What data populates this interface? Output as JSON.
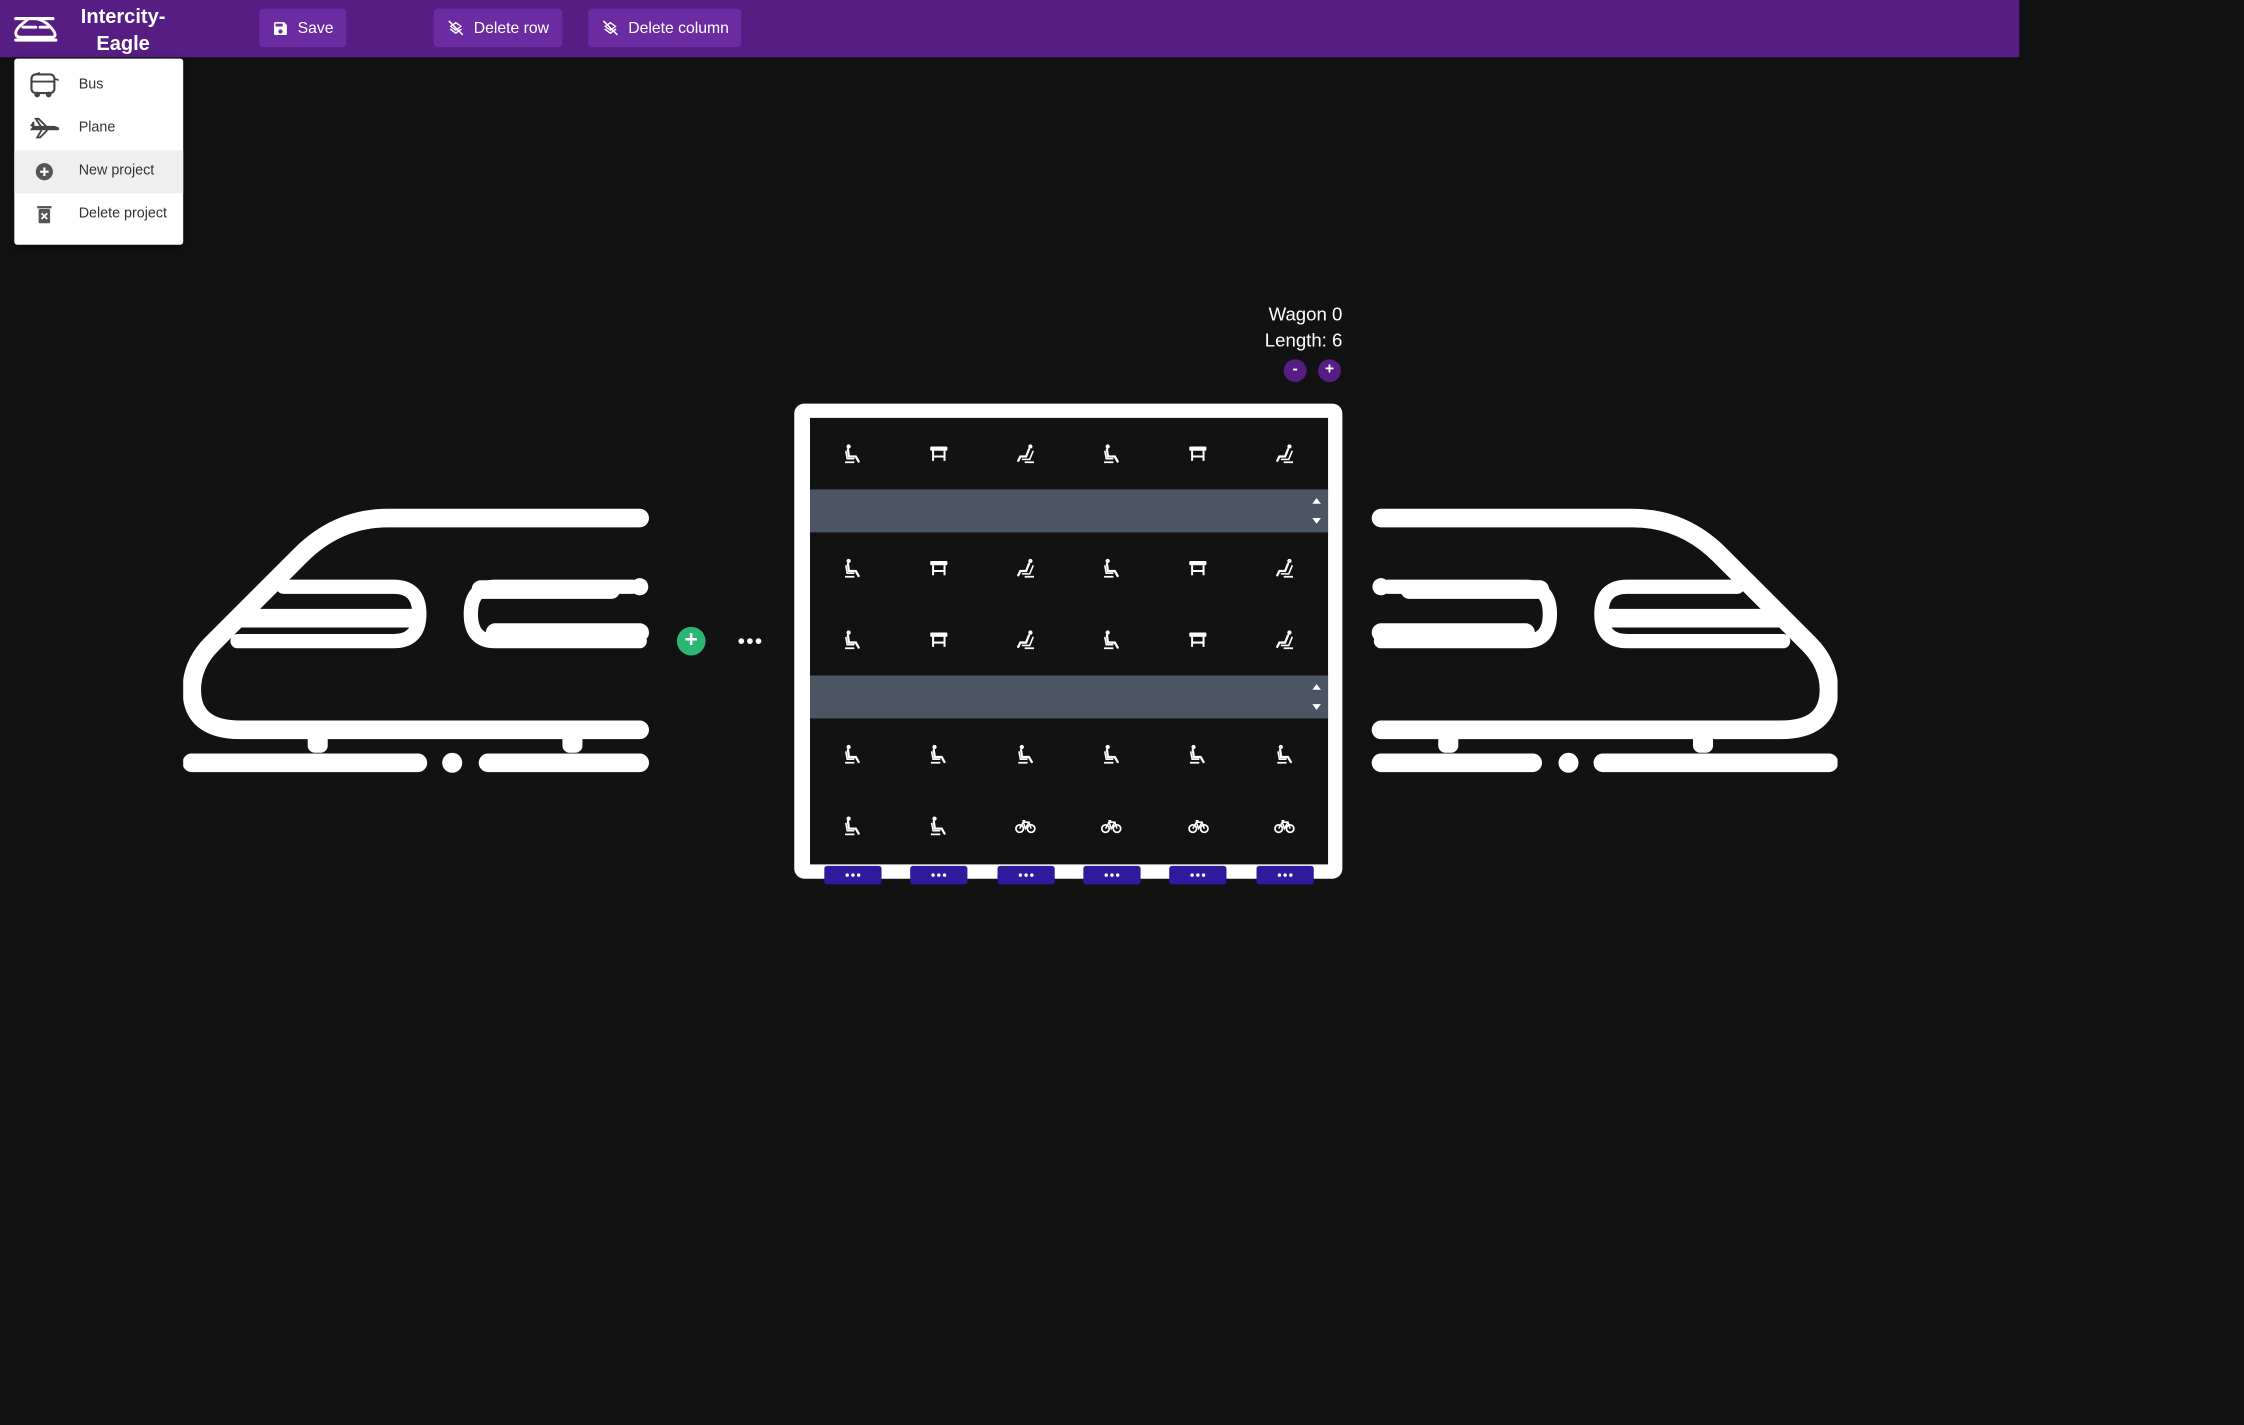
{
  "app": {
    "title_line1": "Intercity-",
    "title_line2": "Eagle"
  },
  "toolbar": {
    "save_label": "Save",
    "delete_row_label": "Delete row",
    "delete_column_label": "Delete column"
  },
  "menu": {
    "items": [
      {
        "label": "Bus",
        "icon": "bus-icon"
      },
      {
        "label": "Plane",
        "icon": "plane-icon"
      },
      {
        "label": "New project",
        "icon": "add-circle-icon"
      },
      {
        "label": "Delete project",
        "icon": "trash-icon"
      }
    ]
  },
  "wagon": {
    "name": "Wagon 0",
    "length_label": "Length: 6",
    "decrease_label": "-",
    "increase_label": "+"
  },
  "add_wagon_label": "+",
  "grid": {
    "columns": 6,
    "rows": [
      {
        "type": "seats",
        "cells": [
          "seat-recline",
          "table",
          "seat-lounge",
          "seat-recline",
          "table",
          "seat-lounge"
        ]
      },
      {
        "type": "aisle"
      },
      {
        "type": "seats",
        "cells": [
          "seat-recline",
          "table",
          "seat-lounge",
          "seat-recline",
          "table",
          "seat-lounge"
        ]
      },
      {
        "type": "seats",
        "cells": [
          "seat-recline",
          "table",
          "seat-lounge",
          "seat-recline",
          "table",
          "seat-lounge"
        ]
      },
      {
        "type": "aisle"
      },
      {
        "type": "seats",
        "cells": [
          "seat-recline",
          "seat-recline",
          "seat-recline",
          "seat-recline",
          "seat-recline",
          "seat-recline"
        ]
      },
      {
        "type": "seats",
        "cells": [
          "seat-recline",
          "seat-recline",
          "bicycle",
          "bicycle",
          "bicycle",
          "bicycle"
        ]
      }
    ]
  },
  "colors": {
    "topbar": "#561d83",
    "button": "#6a2ca0",
    "background": "#121212",
    "aisle": "#4b5563",
    "add": "#2bb673",
    "column_button": "#2f1a9e"
  }
}
